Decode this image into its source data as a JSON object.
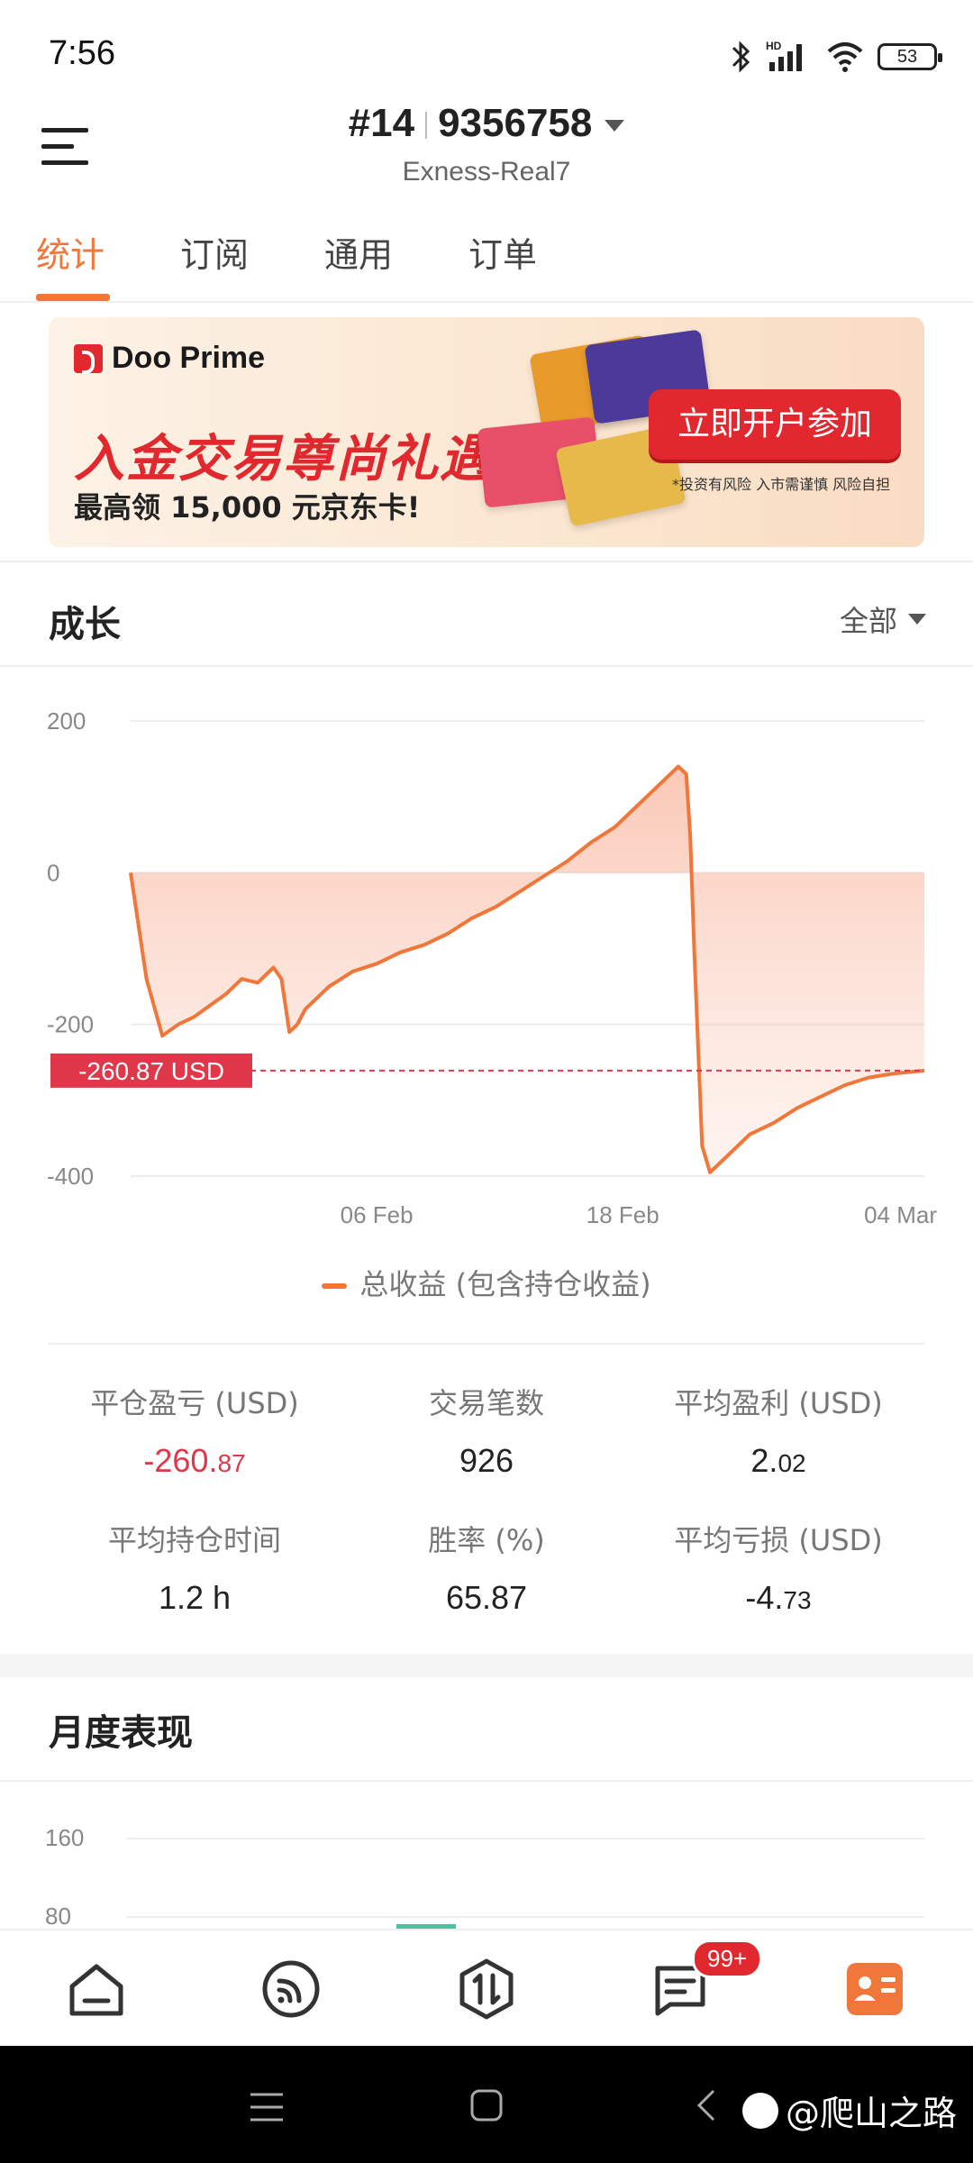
{
  "status_bar": {
    "time": "7:56",
    "battery": "53",
    "network_label": "HD"
  },
  "header": {
    "account_prefix": "#14",
    "account_number": "9356758",
    "server": "Exness-Real7"
  },
  "tabs": [
    {
      "label": "统计",
      "active": true
    },
    {
      "label": "订阅",
      "active": false
    },
    {
      "label": "通用",
      "active": false
    },
    {
      "label": "订单",
      "active": false
    }
  ],
  "banner": {
    "brand": "Doo Prime",
    "headline": "入金交易尊尚礼遇",
    "subline": "最高领 15,000 元京东卡!",
    "cta": "立即开户参加",
    "note": "*投资有风险 入市需谨慎 风险自担"
  },
  "growth": {
    "title": "成长",
    "filter": "全部"
  },
  "chart_data": {
    "type": "area",
    "title": "",
    "xlabel": "",
    "ylabel": "",
    "ylim": [
      -400,
      200
    ],
    "yticks": [
      "200",
      "0",
      "-200",
      "-400"
    ],
    "xticks": [
      "06 Feb",
      "18 Feb",
      "04 Mar"
    ],
    "x": [
      0,
      0.02,
      0.04,
      0.06,
      0.08,
      0.1,
      0.12,
      0.14,
      0.16,
      0.18,
      0.19,
      0.2,
      0.21,
      0.22,
      0.23,
      0.25,
      0.28,
      0.31,
      0.34,
      0.37,
      0.4,
      0.43,
      0.46,
      0.49,
      0.52,
      0.55,
      0.58,
      0.61,
      0.64,
      0.67,
      0.69,
      0.7,
      0.705,
      0.71,
      0.72,
      0.73,
      0.75,
      0.78,
      0.81,
      0.84,
      0.87,
      0.9,
      0.93,
      0.96,
      1.0
    ],
    "series": [
      {
        "name": "总收益 (包含持仓收益)",
        "values": [
          0,
          -140,
          -215,
          -200,
          -190,
          -175,
          -160,
          -140,
          -145,
          -125,
          -140,
          -210,
          -200,
          -180,
          -170,
          -150,
          -130,
          -120,
          -105,
          -95,
          -80,
          -60,
          -45,
          -25,
          -5,
          15,
          40,
          60,
          90,
          120,
          140,
          130,
          50,
          -100,
          -360,
          -395,
          -375,
          -345,
          -330,
          -310,
          -295,
          -280,
          -270,
          -265,
          -260.87
        ]
      }
    ],
    "reference_line": {
      "value": -260.87,
      "label": "-260.87 USD"
    },
    "legend_position": "bottom",
    "grid": true
  },
  "legend": {
    "label": "总收益 (包含持仓收益)"
  },
  "stats": {
    "closed_pnl": {
      "label": "平仓盈亏 (USD)",
      "value_int": "-260.",
      "value_dec": "87"
    },
    "trades": {
      "label": "交易笔数",
      "value": "926"
    },
    "avg_profit": {
      "label": "平均盈利 (USD)",
      "value_int": "2.",
      "value_dec": "02"
    },
    "avg_hold": {
      "label": "平均持仓时间",
      "value": "1.2 h"
    },
    "win_rate": {
      "label": "胜率 (%)",
      "value": "65.87"
    },
    "avg_loss": {
      "label": "平均亏损 (USD)",
      "value_int": "-4.",
      "value_dec": "73"
    }
  },
  "monthly": {
    "title": "月度表现",
    "yticks": [
      "160",
      "80"
    ]
  },
  "bottom_nav": {
    "badge": "99+"
  },
  "watermark": {
    "text": "@爬山之路"
  },
  "colors": {
    "accent": "#f0763a",
    "negative": "#e0374a",
    "brand_red": "#e0282e"
  }
}
